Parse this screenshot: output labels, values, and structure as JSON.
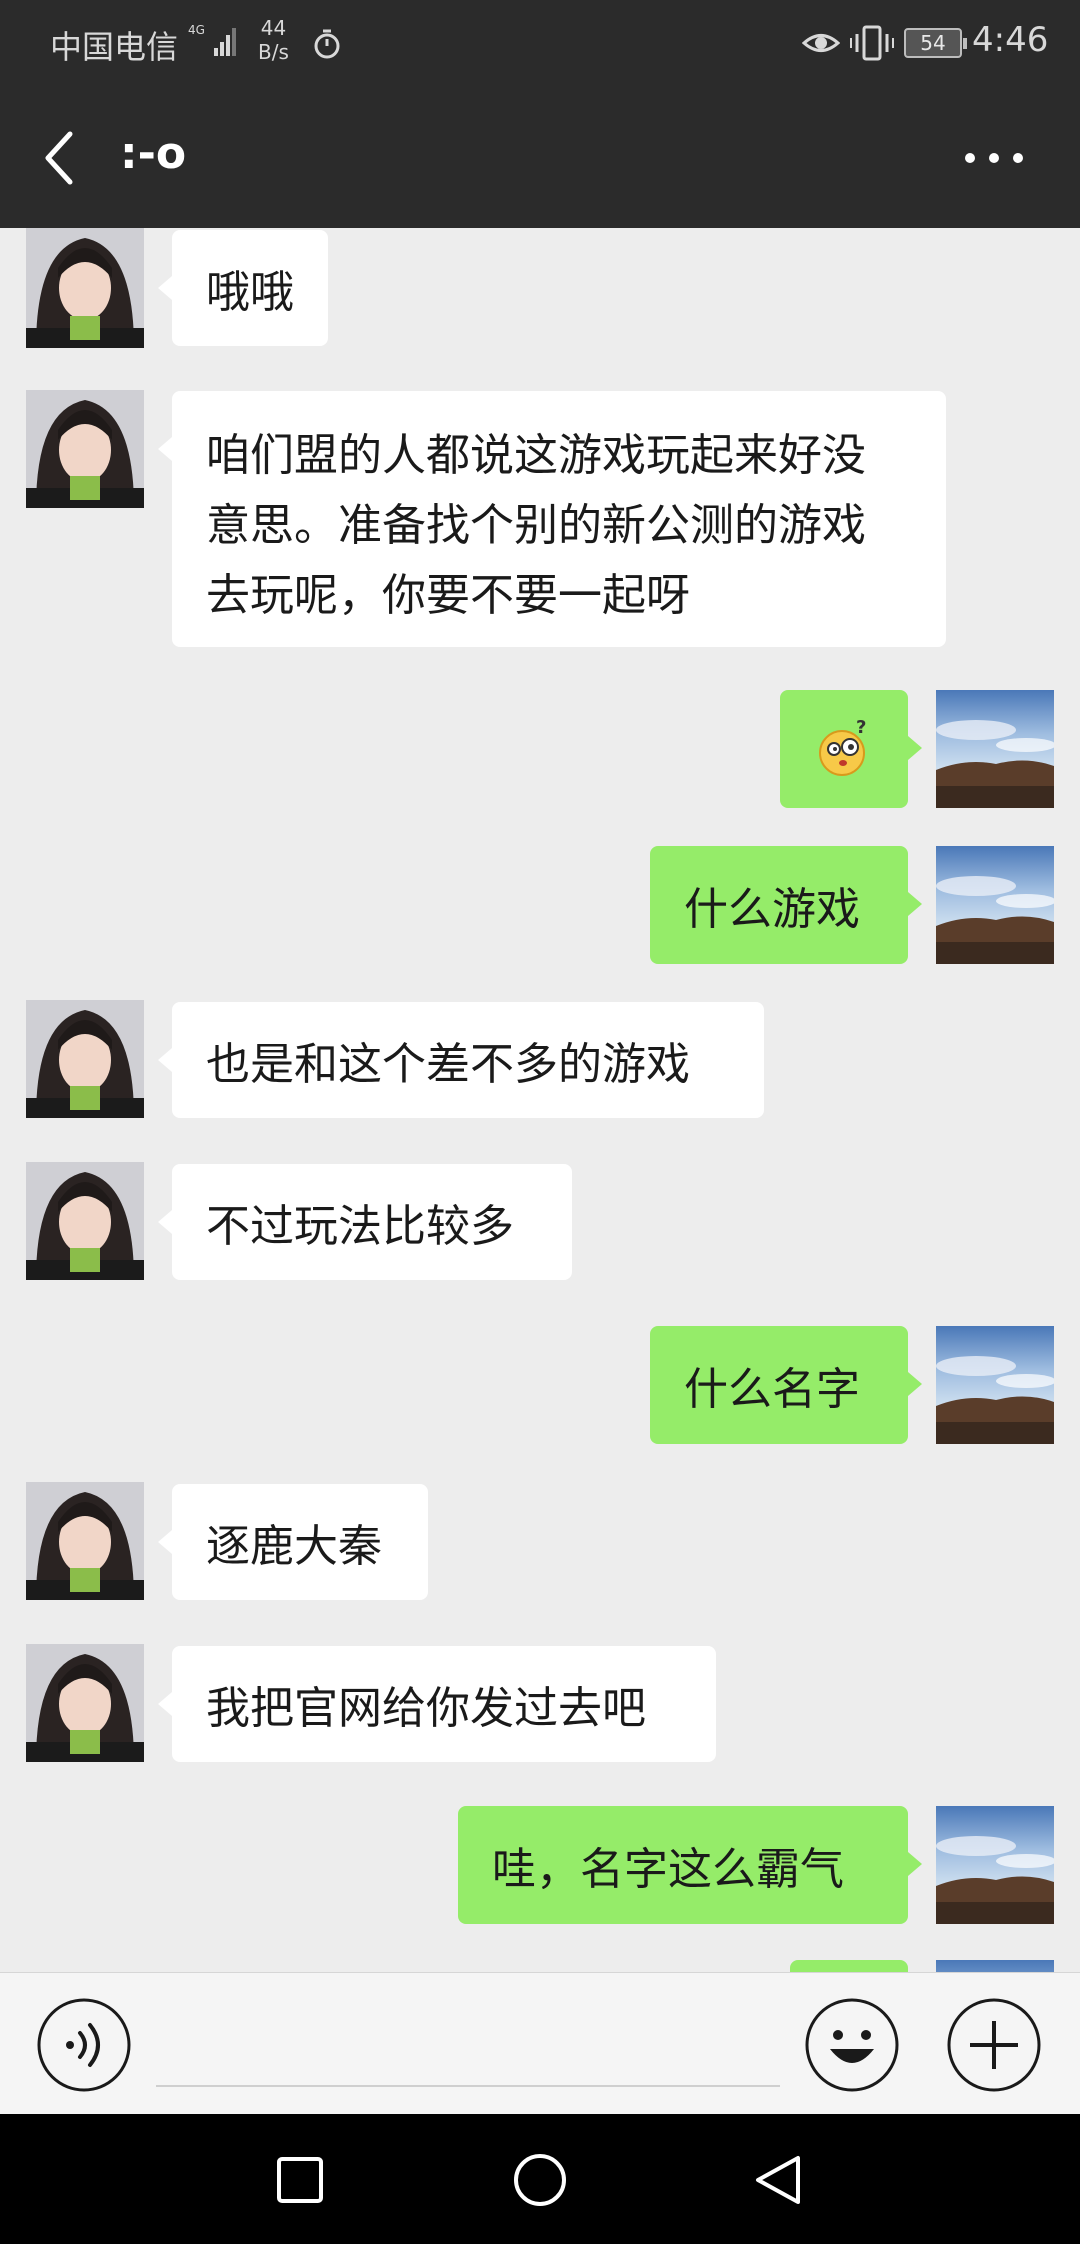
{
  "status_bar": {
    "carrier": "中国电信",
    "network_type": "4G",
    "speed_value": "44",
    "speed_unit": "B/s",
    "battery": "54",
    "time": "4:46"
  },
  "header": {
    "title": ":-o"
  },
  "messages": [
    {
      "side": "left",
      "text": "哦哦"
    },
    {
      "side": "left",
      "lines": [
        "咱们盟的人都说这游戏玩起来好没",
        "意思。准备找个别的新公测的游戏",
        "去玩呢，你要不要一起呀"
      ]
    },
    {
      "side": "right",
      "type": "emoji",
      "emoji": "confused-face"
    },
    {
      "side": "right",
      "text": "什么游戏"
    },
    {
      "side": "left",
      "text": "也是和这个差不多的游戏"
    },
    {
      "side": "left",
      "text": "不过玩法比较多"
    },
    {
      "side": "right",
      "text": "什么名字"
    },
    {
      "side": "left",
      "text": "逐鹿大秦"
    },
    {
      "side": "left",
      "text": "我把官网给你发过去吧"
    },
    {
      "side": "right",
      "text": "哇，名字这么霸气"
    }
  ],
  "colors": {
    "header_bg": "#2b2b2b",
    "chat_bg": "#ededed",
    "sent_bubble": "#95ec69",
    "received_bubble": "#ffffff"
  }
}
